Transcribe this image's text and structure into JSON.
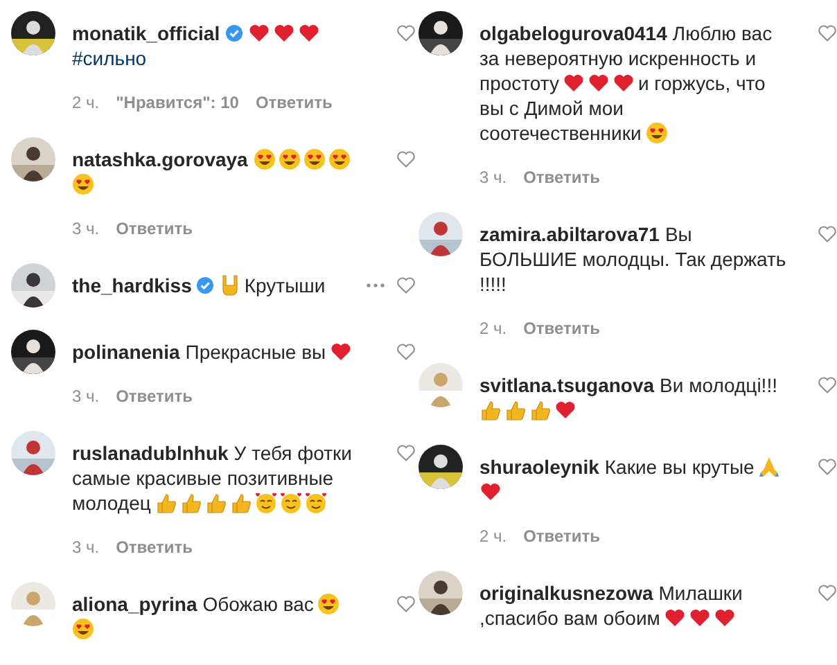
{
  "columns": [
    {
      "comments": [
        {
          "username": "monatik_official",
          "verified": true,
          "body": [
            {
              "kind": "heart"
            },
            {
              "kind": "heart"
            },
            {
              "kind": "heart"
            },
            {
              "kind": "hashtag",
              "text": "#сильно"
            }
          ],
          "time": "2 ч.",
          "likes": "\"Нравится\": 10",
          "reply": "Ответить",
          "more": false,
          "liked": false
        },
        {
          "username": "natashka.gorovaya",
          "verified": false,
          "body": [
            {
              "kind": "heart-eyes"
            },
            {
              "kind": "heart-eyes"
            },
            {
              "kind": "heart-eyes"
            },
            {
              "kind": "heart-eyes"
            },
            {
              "kind": "heart-eyes"
            }
          ],
          "time": "3 ч.",
          "reply": "Ответить",
          "more": false,
          "liked": false
        },
        {
          "username": "the_hardkiss",
          "verified": true,
          "body": [
            {
              "kind": "rock-hand"
            },
            {
              "kind": "text",
              "text": "Крутыши"
            }
          ],
          "more": true,
          "liked": false
        },
        {
          "username": "polinanenia",
          "verified": false,
          "body": [
            {
              "kind": "text",
              "text": "Прекрасные вы"
            },
            {
              "kind": "heart"
            }
          ],
          "time": "3 ч.",
          "reply": "Ответить",
          "more": false,
          "liked": false
        },
        {
          "username": "ruslanadublnhuk",
          "verified": false,
          "body": [
            {
              "kind": "text",
              "text": "У тебя фотки самые красивые позитивные молодец"
            },
            {
              "kind": "thumbs-up"
            },
            {
              "kind": "thumbs-up"
            },
            {
              "kind": "thumbs-up"
            },
            {
              "kind": "thumbs-up"
            },
            {
              "kind": "smiling-hearts"
            },
            {
              "kind": "smiling-hearts"
            },
            {
              "kind": "smiling-hearts"
            }
          ],
          "time": "3 ч.",
          "reply": "Ответить",
          "more": false,
          "liked": false
        },
        {
          "username": "aliona_pyrina",
          "verified": false,
          "body": [
            {
              "kind": "text",
              "text": "Обожаю вас"
            },
            {
              "kind": "heart-eyes"
            },
            {
              "kind": "heart-eyes"
            }
          ],
          "more": false,
          "liked": false
        }
      ]
    },
    {
      "comments": [
        {
          "username": "olgabelogurova0414",
          "verified": false,
          "body": [
            {
              "kind": "text",
              "text": "Люблю вас за невероятную искренность и простоту"
            },
            {
              "kind": "heart"
            },
            {
              "kind": "heart"
            },
            {
              "kind": "heart"
            },
            {
              "kind": "text",
              "text": "и горжусь, что вы с Димой мои соотечественники"
            },
            {
              "kind": "heart-eyes"
            }
          ],
          "time": "3 ч.",
          "reply": "Ответить",
          "more": false,
          "liked": false
        },
        {
          "username": "zamira.abiltarova71",
          "verified": false,
          "body": [
            {
              "kind": "text",
              "text": "Вы БОЛЬШИЕ молодцы. Так держать !!!!!"
            }
          ],
          "time": "2 ч.",
          "reply": "Ответить",
          "more": false,
          "liked": false
        },
        {
          "username": "svitlana.tsuganova",
          "verified": false,
          "body": [
            {
              "kind": "text",
              "text": "Ви молодці!!!"
            },
            {
              "kind": "thumbs-up"
            },
            {
              "kind": "thumbs-up"
            },
            {
              "kind": "thumbs-up"
            },
            {
              "kind": "heart"
            }
          ],
          "more": false,
          "liked": false
        },
        {
          "username": "shuraoleynik",
          "verified": false,
          "body": [
            {
              "kind": "text",
              "text": "Какие вы крутые"
            },
            {
              "kind": "pray"
            },
            {
              "kind": "heart"
            }
          ],
          "time": "2 ч.",
          "reply": "Ответить",
          "more": false,
          "liked": false
        },
        {
          "username": "originalkusnezowa",
          "verified": false,
          "body": [
            {
              "kind": "text",
              "text": "Милашки ,спасибо вам обоим"
            },
            {
              "kind": "heart"
            },
            {
              "kind": "heart"
            },
            {
              "kind": "heart"
            }
          ],
          "more": false,
          "liked": false
        }
      ]
    }
  ]
}
